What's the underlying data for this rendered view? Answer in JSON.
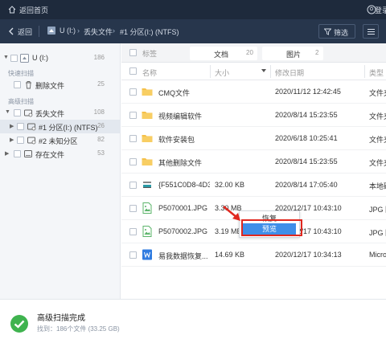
{
  "titlebar": {
    "home_label": "返回首页",
    "login_label": "登录",
    "icon_home": "home-icon",
    "icon_user": "user-icon"
  },
  "navbar": {
    "back_label": "返回",
    "breadcrumb": [
      "U (I:)",
      "丢失文件",
      "#1 分区(I:) (NTFS)"
    ],
    "filter_label": "筛选"
  },
  "sidebar": {
    "root": {
      "label": "U (I:)",
      "count": "186"
    },
    "quick_scan_label": "快速扫描",
    "deleted": {
      "label": "删除文件",
      "count": "25"
    },
    "advanced_scan_label": "高级扫描",
    "lost": {
      "label": "丢失文件",
      "count": "108"
    },
    "part1": {
      "label": "#1 分区(I:) (NTFS)",
      "count": "26"
    },
    "part2": {
      "label": "#2 未知分区",
      "count": "82"
    },
    "existing": {
      "label": "存在文件",
      "count": "53"
    }
  },
  "tabs": {
    "tag_label": "标签",
    "items": [
      {
        "label": "文档",
        "count": "20"
      },
      {
        "label": "图片",
        "count": "2"
      }
    ]
  },
  "table": {
    "headers": {
      "name": "名称",
      "size": "大小",
      "date": "修改日期",
      "type": "类型"
    },
    "rows": [
      {
        "name": "CMQ文件",
        "size": "",
        "date": "2020/11/12 12:42:45",
        "type": "文件夹",
        "icon": "folder-icon"
      },
      {
        "name": "视频编辑软件",
        "size": "",
        "date": "2020/8/14 15:23:55",
        "type": "文件夹",
        "icon": "folder-icon"
      },
      {
        "name": "软件安装包",
        "size": "",
        "date": "2020/6/18 10:25:41",
        "type": "文件夹",
        "icon": "folder-icon"
      },
      {
        "name": "其他删除文件",
        "size": "",
        "date": "2020/8/14 15:23:55",
        "type": "文件夹",
        "icon": "folder-icon"
      },
      {
        "name": "{F551C0D8-4D3...",
        "size": "32.00 KB",
        "date": "2020/8/14 17:05:40",
        "type": "本地磁盘",
        "icon": "system-file-icon"
      },
      {
        "name": "P5070001.JPG",
        "size": "3.30 MB",
        "date": "2020/12/17 10:43:10",
        "type": "JPG 图片",
        "icon": "image-file-icon"
      },
      {
        "name": "P5070002.JPG",
        "size": "3.19 MB",
        "date": "2020/12/17 10:43:10",
        "type": "JPG 图片",
        "icon": "image-file-icon"
      },
      {
        "name": "易我数据恢复...",
        "size": "14.69 KB",
        "date": "2020/12/17 10:34:13",
        "type": "Microsoft",
        "icon": "word-file-icon"
      }
    ]
  },
  "context_menu": {
    "restore": "恢复",
    "preview": "预览"
  },
  "status": {
    "title": "高级扫描完成",
    "found": "找到：186个文件 (33.25 GB)"
  },
  "colors": {
    "titlebar": "#1e2a3c",
    "navbar": "#27364c",
    "accent": "#3f8ee8",
    "highlight_box": "#e0281f",
    "success": "#3fb34f",
    "folder": "#f5c04a"
  }
}
